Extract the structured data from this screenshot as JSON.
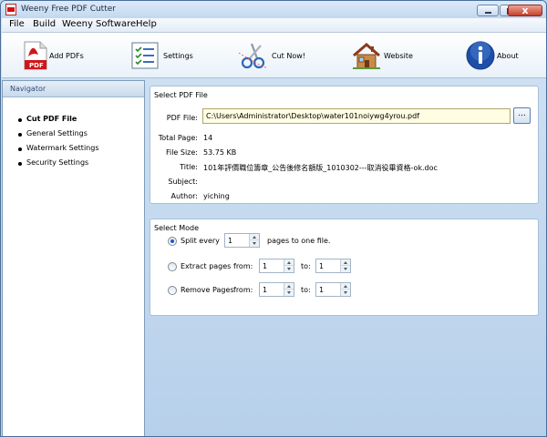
{
  "window": {
    "title": "Weeny Free PDF Cutter",
    "close_glyph": "x"
  },
  "menu": [
    {
      "label": "File"
    },
    {
      "label": "Build"
    },
    {
      "label": "Weeny Software"
    },
    {
      "label": "Help"
    }
  ],
  "toolbar": {
    "add_pdfs": "Add PDFs",
    "settings": "Settings",
    "cut_now": "Cut Now!",
    "website": "Website",
    "about": "About"
  },
  "navigator": {
    "title": "Navigator",
    "items": [
      {
        "label": "Cut PDF File",
        "active": true
      },
      {
        "label": "General Settings"
      },
      {
        "label": "Watermark Settings"
      },
      {
        "label": "Security Settings"
      }
    ]
  },
  "select_pdf": {
    "title": "Select PDF File",
    "file_label": "PDF File:",
    "file_value": "C:\\Users\\Administrator\\Desktop\\water101noiywg4yrou.pdf",
    "browse_label": "...",
    "total_page_label": "Total Page:",
    "total_page_value": "14",
    "file_size_label": "File Size:",
    "file_size_value": "53.75 KB",
    "title_label": "Title:",
    "title_value": "101年評價職位籌章_公告後修名額版_1010302---取消役畢資格-ok.doc",
    "subject_label": "Subject:",
    "subject_value": "",
    "author_label": "Author:",
    "author_value": "yiching"
  },
  "select_mode": {
    "title": "Select Mode",
    "split": {
      "label": "Split every",
      "value": "1",
      "suffix": "pages to one file.",
      "selected": true
    },
    "extract": {
      "label": "Extract pages",
      "from_label": "from:",
      "from_value": "1",
      "to_label": "to:",
      "to_value": "1"
    },
    "remove": {
      "label": "Remove Pages",
      "from_label": "from:",
      "from_value": "1",
      "to_label": "to:",
      "to_value": "1"
    }
  }
}
